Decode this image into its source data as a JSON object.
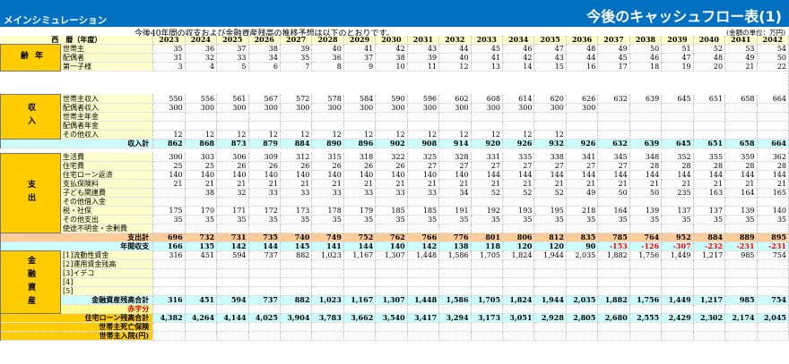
{
  "header": {
    "app_title": "メインシミュレーション",
    "sheet_title": "今後のキャッシュフロー表(1)"
  },
  "description": "今後40年間の収支および金融資産残高の推移予想は以下のとおりです。",
  "unit_note": "(金額の単位：万円)",
  "year_header": "西　暦（年度）",
  "years": [
    "2023",
    "2024",
    "2025",
    "2026",
    "2027",
    "2028",
    "2029",
    "2030",
    "2031",
    "2032",
    "2033",
    "2034",
    "2035",
    "2036",
    "2037",
    "2038",
    "2039",
    "2040",
    "2041",
    "2042"
  ],
  "sections": {
    "age": "年齢",
    "income": "収入",
    "expense": "支出",
    "assets": "金融資産"
  },
  "rows": {
    "age": [
      {
        "label": "世帯主",
        "values": [
          "35",
          "36",
          "37",
          "38",
          "39",
          "40",
          "41",
          "42",
          "43",
          "44",
          "45",
          "46",
          "47",
          "48",
          "49",
          "50",
          "51",
          "52",
          "53",
          "54"
        ]
      },
      {
        "label": "配偶者",
        "values": [
          "31",
          "32",
          "33",
          "34",
          "35",
          "36",
          "37",
          "38",
          "39",
          "40",
          "41",
          "42",
          "43",
          "44",
          "45",
          "46",
          "47",
          "48",
          "49",
          "50"
        ]
      },
      {
        "label": "第一子様",
        "values": [
          "3",
          "4",
          "5",
          "6",
          "7",
          "8",
          "9",
          "10",
          "11",
          "12",
          "13",
          "14",
          "15",
          "16",
          "17",
          "18",
          "19",
          "20",
          "21",
          "22"
        ]
      }
    ],
    "income": [
      {
        "label": "世帯主収入",
        "values": [
          "550",
          "556",
          "561",
          "567",
          "572",
          "578",
          "584",
          "590",
          "596",
          "602",
          "608",
          "614",
          "620",
          "626",
          "632",
          "639",
          "645",
          "651",
          "658",
          "664"
        ]
      },
      {
        "label": "配偶者収入",
        "values": [
          "300",
          "300",
          "300",
          "300",
          "300",
          "300",
          "300",
          "300",
          "300",
          "300",
          "300",
          "300",
          "300",
          "300",
          "",
          "",
          "",
          "",
          "",
          ""
        ]
      },
      {
        "label": "世帯主年金",
        "values": [
          "",
          "",
          "",
          "",
          "",
          "",
          "",
          "",
          "",
          "",
          "",
          "",
          "",
          "",
          "",
          "",
          "",
          "",
          "",
          ""
        ]
      },
      {
        "label": "配偶者年金",
        "values": [
          "",
          "",
          "",
          "",
          "",
          "",
          "",
          "",
          "",
          "",
          "",
          "",
          "",
          "",
          "",
          "",
          "",
          "",
          "",
          ""
        ]
      },
      {
        "label": "その他収入",
        "values": [
          "12",
          "12",
          "12",
          "12",
          "12",
          "12",
          "12",
          "12",
          "12",
          "12",
          "12",
          "12",
          "12",
          "",
          "",
          "",
          "",
          "",
          "",
          ""
        ]
      }
    ],
    "income_total": {
      "label": "収入計",
      "values": [
        "862",
        "868",
        "873",
        "879",
        "884",
        "890",
        "896",
        "902",
        "908",
        "914",
        "920",
        "926",
        "932",
        "926",
        "632",
        "639",
        "645",
        "651",
        "658",
        "664"
      ]
    },
    "expense": [
      {
        "label": "生活費",
        "values": [
          "300",
          "303",
          "306",
          "309",
          "312",
          "315",
          "318",
          "322",
          "325",
          "328",
          "331",
          "335",
          "338",
          "341",
          "345",
          "348",
          "352",
          "355",
          "359",
          "362"
        ]
      },
      {
        "label": "住宅費",
        "values": [
          "25",
          "25",
          "26",
          "26",
          "26",
          "26",
          "26",
          "26",
          "27",
          "27",
          "27",
          "27",
          "27",
          "27",
          "27",
          "28",
          "28",
          "28",
          "28",
          "28"
        ]
      },
      {
        "label": "住宅ローン返済",
        "values": [
          "140",
          "140",
          "140",
          "140",
          "140",
          "140",
          "140",
          "140",
          "140",
          "140",
          "144",
          "144",
          "144",
          "144",
          "144",
          "144",
          "144",
          "144",
          "144",
          "144"
        ]
      },
      {
        "label": "支払保険料",
        "values": [
          "21",
          "21",
          "21",
          "21",
          "21",
          "21",
          "21",
          "21",
          "21",
          "21",
          "21",
          "21",
          "21",
          "21",
          "21",
          "21",
          "21",
          "21",
          "21",
          "21"
        ]
      },
      {
        "label": "子ども関連費",
        "values": [
          "",
          "38",
          "32",
          "33",
          "33",
          "33",
          "33",
          "33",
          "33",
          "34",
          "52",
          "52",
          "52",
          "49",
          "50",
          "50",
          "235",
          "163",
          "164",
          "165"
        ]
      },
      {
        "label": "その他借入金",
        "values": [
          "",
          "",
          "",
          "",
          "",
          "",
          "",
          "",
          "",
          "",
          "",
          "",
          "",
          "",
          "",
          "",
          "",
          "",
          "",
          ""
        ]
      },
      {
        "label": "税・社保",
        "values": [
          "175",
          "170",
          "171",
          "172",
          "173",
          "178",
          "179",
          "185",
          "185",
          "191",
          "192",
          "193",
          "195",
          "218",
          "164",
          "139",
          "137",
          "137",
          "139",
          "140"
        ]
      },
      {
        "label": "その他支出",
        "values": [
          "35",
          "35",
          "35",
          "35",
          "35",
          "35",
          "35",
          "35",
          "35",
          "35",
          "35",
          "35",
          "35",
          "35",
          "35",
          "35",
          "35",
          "35",
          "35",
          "35"
        ]
      },
      {
        "label": "使途不明金・余剰費",
        "values": [
          "",
          "",
          "",
          "",
          "",
          "",
          "",
          "",
          "",
          "",
          "",
          "",
          "",
          "",
          "",
          "",
          "",
          "",
          "",
          ""
        ]
      }
    ],
    "expense_total": {
      "label": "支出計",
      "values": [
        "696",
        "732",
        "731",
        "735",
        "740",
        "749",
        "752",
        "762",
        "766",
        "776",
        "801",
        "806",
        "812",
        "835",
        "785",
        "764",
        "952",
        "884",
        "889",
        "895"
      ]
    },
    "annual_balance": {
      "label": "年間収支",
      "values": [
        "166",
        "135",
        "142",
        "144",
        "145",
        "141",
        "144",
        "140",
        "142",
        "138",
        "118",
        "120",
        "120",
        "90",
        "-153",
        "-126",
        "-307",
        "-232",
        "-231",
        "-231"
      ]
    },
    "assets": [
      {
        "label": "[1]流動性資金",
        "values": [
          "316",
          "451",
          "594",
          "737",
          "882",
          "1,023",
          "1,167",
          "1,307",
          "1,448",
          "1,586",
          "1,705",
          "1,824",
          "1,944",
          "2,035",
          "1,882",
          "1,756",
          "1,449",
          "1,217",
          "985",
          "754"
        ]
      },
      {
        "label": "[2]運用資金残高",
        "values": [
          "",
          "",
          "",
          "",
          "",
          "",
          "",
          "",
          "",
          "",
          "",
          "",
          "",
          "",
          "",
          "",
          "",
          "",
          "",
          ""
        ]
      },
      {
        "label": "[3]イデコ",
        "values": [
          "",
          "",
          "",
          "",
          "",
          "",
          "",
          "",
          "",
          "",
          "",
          "",
          "",
          "",
          "",
          "",
          "",
          "",
          "",
          ""
        ]
      },
      {
        "label": "[4]",
        "values": [
          "",
          "",
          "",
          "",
          "",
          "",
          "",
          "",
          "",
          "",
          "",
          "",
          "",
          "",
          "",
          "",
          "",
          "",
          "",
          ""
        ]
      },
      {
        "label": "[5]",
        "values": [
          "",
          "",
          "",
          "",
          "",
          "",
          "",
          "",
          "",
          "",
          "",
          "",
          "",
          "",
          "",
          "",
          "",
          "",
          "",
          ""
        ]
      }
    ],
    "assets_total": {
      "label": "金融資産残高合計",
      "values": [
        "316",
        "451",
        "594",
        "737",
        "882",
        "1,023",
        "1,167",
        "1,307",
        "1,448",
        "1,586",
        "1,705",
        "1,824",
        "1,944",
        "2,035",
        "1,882",
        "1,756",
        "1,449",
        "1,217",
        "985",
        "754"
      ]
    },
    "deficit": {
      "label": "赤字分",
      "values": [
        "",
        "",
        "",
        "",
        "",
        "",
        "",
        "",
        "",
        "",
        "",
        "",
        "",
        "",
        "",
        "",
        "",
        "",
        "",
        ""
      ]
    },
    "loan_balance": {
      "label": "住宅ローン残高合計",
      "values": [
        "4,382",
        "4,264",
        "4,144",
        "4,025",
        "3,904",
        "3,783",
        "3,662",
        "3,540",
        "3,417",
        "3,294",
        "3,173",
        "3,051",
        "2,928",
        "2,805",
        "2,680",
        "2,555",
        "2,429",
        "2,302",
        "2,174",
        "2,045"
      ]
    },
    "death_insurance": {
      "label": "世帯主死亡保険",
      "values": [
        "",
        "",
        "",
        "",
        "",
        "",
        "",
        "",
        "",
        "",
        "",
        "",
        "",
        "",
        "",
        "",
        "",
        "",
        "",
        ""
      ]
    },
    "hospital": {
      "label": "世帯主入院(円)",
      "values": [
        "",
        "",
        "",
        "",
        "",
        "",
        "",
        "",
        "",
        "",
        "",
        "",
        "",
        "",
        "",
        "",
        "",
        "",
        "",
        ""
      ]
    }
  },
  "colors": {
    "header_bg": "#0070c0",
    "section_bg": "#ffcc00",
    "label_bg": "#ffffcc",
    "total_bg": "#ccffff",
    "expense_total_bg": "#ffcc99",
    "negative": "#ff0000"
  }
}
